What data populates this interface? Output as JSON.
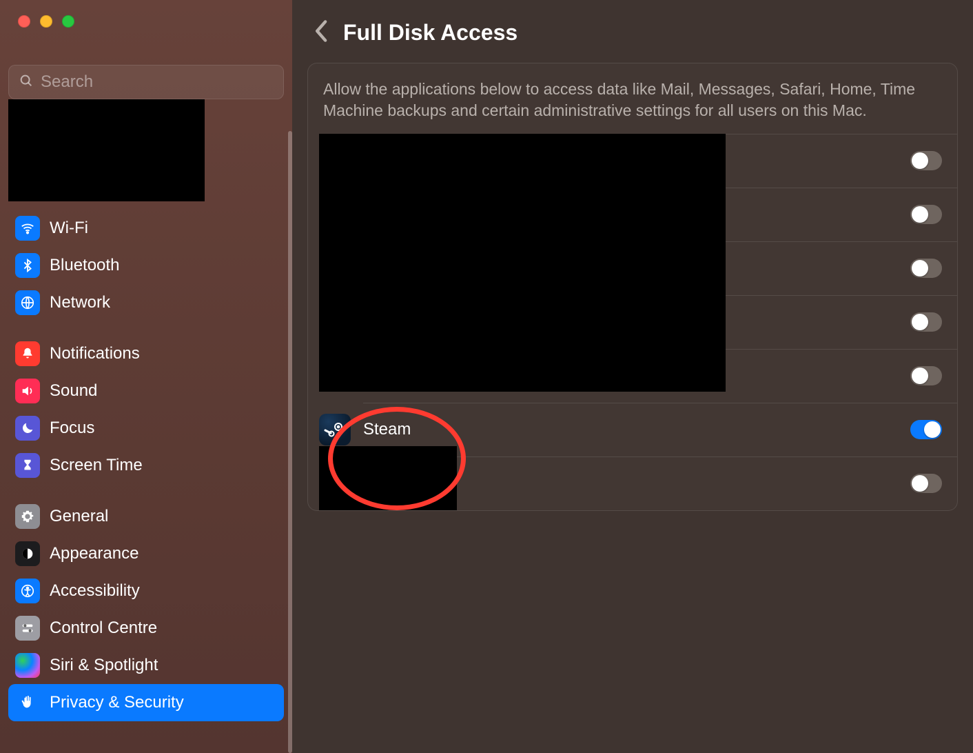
{
  "search": {
    "placeholder": "Search"
  },
  "sidebar": {
    "items": [
      {
        "label": "Wi-Fi"
      },
      {
        "label": "Bluetooth"
      },
      {
        "label": "Network"
      },
      {
        "label": "Notifications"
      },
      {
        "label": "Sound"
      },
      {
        "label": "Focus"
      },
      {
        "label": "Screen Time"
      },
      {
        "label": "General"
      },
      {
        "label": "Appearance"
      },
      {
        "label": "Accessibility"
      },
      {
        "label": "Control Centre"
      },
      {
        "label": "Siri & Spotlight"
      },
      {
        "label": "Privacy & Security"
      }
    ]
  },
  "header": {
    "title": "Full Disk Access"
  },
  "panel": {
    "description": "Allow the applications below to access data like Mail, Messages, Safari, Home, Time Machine backups and certain administrative settings for all users on this Mac."
  },
  "apps": [
    {
      "label": "",
      "enabled": false
    },
    {
      "label": "",
      "enabled": false
    },
    {
      "label": "",
      "enabled": false
    },
    {
      "label": "",
      "enabled": false
    },
    {
      "label": "",
      "enabled": false
    },
    {
      "label": "Steam",
      "enabled": true
    },
    {
      "label": "",
      "enabled": false
    }
  ]
}
